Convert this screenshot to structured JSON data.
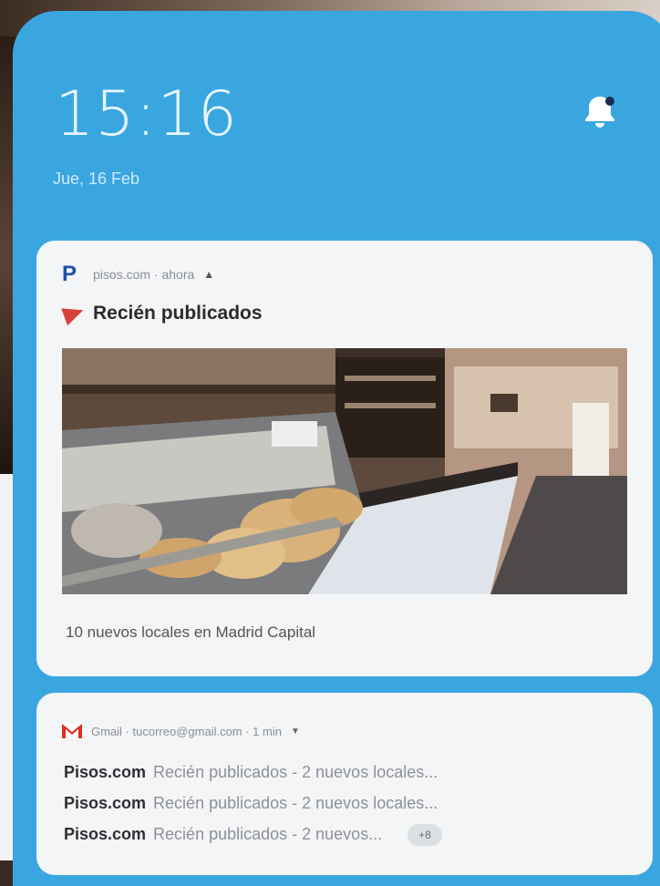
{
  "lockscreen": {
    "time": "15:16",
    "date": "Jue, 16 Feb"
  },
  "notification_1": {
    "app_meta": "pisos.com · ahora",
    "title": "Recién publicados",
    "body": "10 nuevos locales en Madrid Capital"
  },
  "notification_2": {
    "app_meta": "Gmail · tucorreo@gmail.com · 1 min",
    "messages": [
      {
        "sender": "Pisos.com",
        "text": "Recién publicados - 2 nuevos locales..."
      },
      {
        "sender": "Pisos.com",
        "text": "Recién publicados - 2 nuevos locales..."
      },
      {
        "sender": "Pisos.com",
        "text": "Recién publicados - 2 nuevos..."
      }
    ],
    "more_label": "+8"
  },
  "icons": {
    "bell": "bell-icon",
    "pisos_logo": "pisos-logo-icon",
    "pin": "pin-icon",
    "gmail": "gmail-icon",
    "expand": "chevron-up-icon"
  },
  "colors": {
    "lockscreen_bg": "#3aa6e0",
    "card_bg": "#f4f5f6",
    "pin": "#d8403a"
  }
}
